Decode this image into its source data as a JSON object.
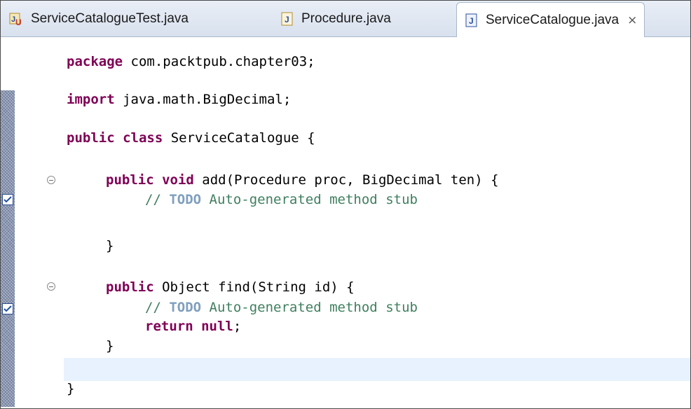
{
  "tabs": [
    {
      "label": "ServiceCatalogueTest.java",
      "icon": "junit-test-file-icon",
      "active": false
    },
    {
      "label": "Procedure.java",
      "icon": "java-file-icon",
      "active": false
    },
    {
      "label": "ServiceCatalogue.java",
      "icon": "java-file-icon",
      "active": true,
      "close": "⨯"
    }
  ],
  "code": {
    "l1": {
      "kw": "package",
      "rest": " com.packtpub.chapter03;"
    },
    "l2": {
      "kw": "import",
      "rest": " java.math.BigDecimal;"
    },
    "l3": {
      "kw": "public class",
      "rest": " ServiceCatalogue {"
    },
    "l4": {
      "kw": "public void",
      "rest": " add(Procedure proc, BigDecimal ten) {"
    },
    "l5": {
      "c1": "// ",
      "todo": "TODO",
      "c2": " Auto-generated method stub"
    },
    "l6": {
      "text": "}"
    },
    "l7": {
      "kw": "public",
      "rest": " Object find(String id) {"
    },
    "l8": {
      "c1": "// ",
      "todo": "TODO",
      "c2": " Auto-generated method stub"
    },
    "l9": {
      "kw": "return null",
      "rest": ";"
    },
    "l10": {
      "text": "}"
    },
    "l11": {
      "text": "}"
    }
  },
  "colors": {
    "keyword": "#7f0055",
    "comment": "#3f7f5f",
    "todo_tag": "#7f9fbf",
    "current_line": "#e8f2fe",
    "overview_ruler": "#8a97b3"
  }
}
